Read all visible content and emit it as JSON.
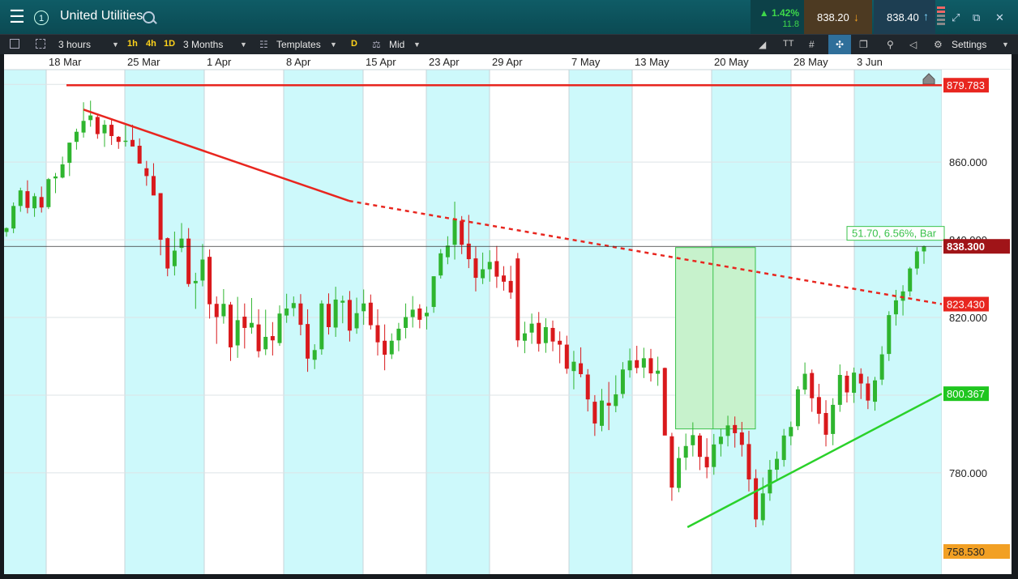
{
  "header": {
    "instrument_number": "1",
    "title": "United Utilities",
    "change_percent": "▲ 1.42%",
    "change_value": "11.8",
    "sell_price": "838.20",
    "buy_price": "838.40"
  },
  "toolbar": {
    "interval": "3 hours",
    "btn_1h": "1h",
    "btn_4h": "4h",
    "btn_1d": "1D",
    "range": "3 Months",
    "templates": "Templates",
    "btn_d": "D",
    "price_type": "Mid",
    "settings": "Settings"
  },
  "colors": {
    "bull": "#2fb52f",
    "bear": "#d9191c",
    "trend_red": "#e8261f",
    "trend_green": "#2ad12a",
    "band": "#cdf9fb",
    "measure_fill": "#c7f2cc"
  },
  "chart_data": {
    "type": "candlestick",
    "x_labels": [
      "18 Mar",
      "25 Mar",
      "1 Apr",
      "8 Apr",
      "15 Apr",
      "23 Apr",
      "29 Apr",
      "7 May",
      "13 May",
      "20 May",
      "28 May",
      "3 Jun"
    ],
    "y_ticks": [
      "880.000",
      "860.000",
      "840.000",
      "820.000",
      "800.000",
      "780.000"
    ],
    "y_tick_values": [
      880,
      860,
      840,
      820,
      800,
      780
    ],
    "ylim": [
      756,
      884
    ],
    "last_price": "838.300",
    "last_price_value": 838.3,
    "low_label": "758.530",
    "horizontal_line": {
      "label": "879.783",
      "value": 879.783
    },
    "resistance_line": {
      "label": "823.430",
      "start": [
        0,
        873.5
      ],
      "pivot": [
        48,
        850
      ],
      "end_value": 823.43
    },
    "support_line": {
      "label": "800.367",
      "start": [
        97,
        766
      ],
      "end_value": 800.367
    },
    "measure": {
      "label": "51.70, 6.56%, Bar",
      "from_value": 791.3,
      "to_value": 838.0,
      "start_index": 96,
      "end_index": 106
    },
    "candles": [
      [
        842.0,
        843.2,
        840.8,
        843.0
      ],
      [
        842.9,
        849.6,
        841.7,
        848.7
      ],
      [
        848.7,
        853.4,
        847.2,
        852.7
      ],
      [
        852.5,
        855.3,
        846.8,
        848.2
      ],
      [
        848.1,
        852.0,
        845.9,
        851.2
      ],
      [
        851.0,
        853.7,
        847.0,
        848.3
      ],
      [
        848.4,
        855.9,
        847.9,
        855.6
      ],
      [
        855.8,
        857.2,
        852.0,
        856.3
      ],
      [
        856.0,
        861.4,
        855.8,
        859.4
      ],
      [
        859.8,
        865.0,
        856.4,
        865.0
      ],
      [
        865.2,
        868.6,
        863.2,
        867.8
      ],
      [
        867.6,
        875.4,
        866.3,
        870.6
      ],
      [
        870.8,
        875.8,
        869.1,
        872.0
      ],
      [
        871.6,
        872.2,
        866.0,
        867.2
      ],
      [
        867.4,
        870.8,
        863.9,
        869.6
      ],
      [
        869.6,
        871.0,
        864.4,
        866.7
      ],
      [
        866.5,
        866.7,
        863.4,
        865.2
      ],
      [
        865.2,
        869.8,
        864.0,
        865.5
      ],
      [
        865.7,
        869.6,
        864.1,
        864.0
      ],
      [
        864.2,
        866.1,
        859.6,
        859.6
      ],
      [
        858.4,
        860.3,
        853.9,
        856.4
      ],
      [
        856.4,
        859.7,
        854.4,
        851.4
      ],
      [
        852.0,
        852.0,
        836.0,
        840.0
      ],
      [
        840.4,
        840.6,
        830.6,
        832.6
      ],
      [
        833.2,
        842.1,
        830.8,
        837.2
      ],
      [
        837.9,
        844.3,
        836.8,
        840.3
      ],
      [
        840.3,
        843.0,
        827.9,
        828.6
      ],
      [
        828.8,
        831.5,
        822.2,
        829.4
      ],
      [
        829.5,
        838.9,
        828.0,
        834.9
      ],
      [
        835.6,
        837.5,
        819.7,
        823.4
      ],
      [
        823.5,
        825.4,
        813.2,
        820.1
      ],
      [
        820.3,
        827.3,
        818.4,
        823.5
      ],
      [
        823.3,
        824.0,
        808.8,
        812.3
      ],
      [
        812.8,
        825.3,
        809.6,
        819.3
      ],
      [
        820.2,
        823.6,
        812.0,
        817.3
      ],
      [
        817.4,
        825.0,
        815.8,
        818.6
      ],
      [
        818.2,
        822.1,
        809.7,
        811.3
      ],
      [
        811.8,
        822.0,
        810.3,
        815.0
      ],
      [
        815.2,
        818.8,
        810.2,
        814.1
      ],
      [
        813.4,
        823.1,
        812.7,
        821.0
      ],
      [
        820.5,
        826.1,
        818.6,
        822.3
      ],
      [
        822.4,
        825.4,
        820.3,
        823.7
      ],
      [
        823.6,
        826.0,
        815.4,
        818.1
      ],
      [
        818.3,
        822.1,
        806.0,
        809.4
      ],
      [
        809.1,
        813.1,
        806.7,
        811.6
      ],
      [
        811.8,
        824.4,
        810.4,
        823.6
      ],
      [
        823.5,
        826.2,
        815.6,
        817.5
      ],
      [
        817.4,
        827.9,
        815.0,
        824.6
      ],
      [
        823.8,
        825.6,
        818.5,
        824.3
      ],
      [
        824.5,
        826.8,
        813.8,
        816.6
      ],
      [
        817.2,
        825.1,
        815.8,
        821.1
      ],
      [
        821.6,
        827.2,
        818.1,
        823.6
      ],
      [
        823.8,
        825.9,
        816.9,
        818.0
      ],
      [
        818.0,
        822.1,
        810.2,
        813.6
      ],
      [
        814.0,
        818.2,
        806.4,
        810.4
      ],
      [
        810.5,
        815.9,
        809.3,
        814.0
      ],
      [
        814.1,
        818.6,
        811.3,
        817.1
      ],
      [
        817.3,
        823.6,
        814.6,
        820.1
      ],
      [
        820.1,
        825.5,
        817.4,
        822.0
      ],
      [
        822.3,
        823.4,
        817.2,
        819.4
      ],
      [
        820.3,
        822.8,
        816.9,
        821.2
      ],
      [
        822.7,
        830.6,
        821.2,
        830.6
      ],
      [
        830.8,
        837.6,
        830.0,
        836.5
      ],
      [
        835.5,
        840.9,
        833.7,
        838.5
      ],
      [
        838.7,
        849.8,
        834.9,
        845.3
      ],
      [
        844.9,
        846.1,
        836.3,
        838.7
      ],
      [
        839.0,
        846.4,
        832.7,
        835.0
      ],
      [
        835.2,
        838.2,
        826.7,
        830.2
      ],
      [
        830.1,
        836.7,
        828.6,
        832.4
      ],
      [
        832.4,
        837.3,
        829.2,
        834.3
      ],
      [
        834.5,
        838.4,
        827.6,
        830.5
      ],
      [
        830.8,
        833.2,
        826.9,
        829.2
      ],
      [
        829.4,
        833.3,
        824.8,
        826.4
      ],
      [
        835.2,
        836.6,
        812.4,
        814.1
      ],
      [
        814.0,
        818.9,
        810.8,
        815.9
      ],
      [
        816.1,
        821.0,
        813.2,
        818.4
      ],
      [
        818.6,
        821.4,
        811.2,
        813.2
      ],
      [
        813.4,
        819.8,
        810.9,
        817.5
      ],
      [
        817.3,
        819.2,
        811.3,
        813.8
      ],
      [
        814.0,
        816.4,
        808.2,
        813.0
      ],
      [
        813.0,
        815.3,
        805.5,
        806.8
      ],
      [
        806.2,
        811.4,
        801.5,
        808.6
      ],
      [
        808.2,
        812.3,
        804.6,
        805.4
      ],
      [
        805.3,
        806.7,
        795.8,
        798.9
      ],
      [
        798.3,
        800.0,
        789.5,
        792.7
      ],
      [
        792.1,
        801.6,
        790.7,
        798.6
      ],
      [
        798.0,
        803.4,
        791.0,
        797.3
      ],
      [
        797.2,
        805.1,
        795.6,
        800.2
      ],
      [
        800.3,
        808.5,
        799.2,
        806.6
      ],
      [
        806.4,
        812.0,
        804.5,
        808.9
      ],
      [
        809.0,
        812.7,
        805.6,
        807.0
      ],
      [
        807.1,
        812.2,
        804.4,
        809.5
      ],
      [
        809.5,
        811.9,
        803.5,
        805.6
      ],
      [
        805.5,
        809.9,
        802.4,
        806.3
      ],
      [
        807.0,
        807.1,
        797.0,
        789.6
      ],
      [
        789.4,
        790.3,
        772.8,
        776.2
      ],
      [
        776.1,
        786.7,
        775.0,
        783.8
      ],
      [
        783.9,
        790.1,
        780.7,
        786.9
      ],
      [
        787.1,
        793.0,
        784.2,
        789.7
      ],
      [
        789.6,
        790.2,
        780.7,
        784.1
      ],
      [
        784.1,
        788.9,
        778.6,
        781.4
      ],
      [
        781.5,
        790.0,
        779.5,
        787.3
      ],
      [
        787.4,
        791.4,
        784.2,
        789.3
      ],
      [
        789.5,
        794.7,
        786.8,
        792.2
      ],
      [
        792.3,
        794.5,
        786.5,
        790.2
      ],
      [
        790.4,
        793.1,
        784.2,
        787.2
      ],
      [
        787.4,
        790.8,
        775.2,
        778.3
      ],
      [
        778.6,
        780.9,
        766.0,
        768.0
      ],
      [
        767.8,
        778.8,
        766.5,
        774.7
      ],
      [
        774.7,
        783.3,
        772.8,
        780.8
      ],
      [
        780.8,
        785.5,
        778.0,
        783.6
      ],
      [
        783.3,
        791.3,
        781.6,
        789.6
      ],
      [
        789.4,
        793.2,
        787.1,
        791.8
      ],
      [
        792.0,
        802.3,
        791.0,
        801.5
      ],
      [
        801.4,
        808.4,
        800.2,
        805.5
      ],
      [
        805.7,
        806.6,
        795.7,
        799.2
      ],
      [
        799.5,
        802.9,
        792.6,
        795.2
      ],
      [
        795.4,
        798.7,
        786.8,
        789.8
      ],
      [
        790.0,
        799.2,
        787.1,
        797.5
      ],
      [
        797.5,
        807.9,
        795.7,
        805.2
      ],
      [
        805.0,
        806.2,
        798.1,
        800.7
      ],
      [
        800.6,
        807.1,
        798.0,
        805.8
      ],
      [
        805.5,
        806.9,
        799.0,
        803.0
      ],
      [
        803.0,
        804.8,
        796.4,
        798.6
      ],
      [
        798.3,
        804.7,
        796.0,
        803.8
      ],
      [
        804.0,
        812.6,
        802.6,
        810.5
      ],
      [
        810.6,
        821.6,
        808.8,
        820.6
      ],
      [
        820.8,
        827.1,
        817.9,
        824.4
      ],
      [
        824.3,
        828.3,
        820.5,
        826.7
      ],
      [
        826.7,
        833.0,
        825.4,
        832.6
      ],
      [
        832.6,
        838.1,
        831.0,
        837.0
      ],
      [
        837.0,
        838.5,
        833.8,
        838.3
      ]
    ]
  }
}
